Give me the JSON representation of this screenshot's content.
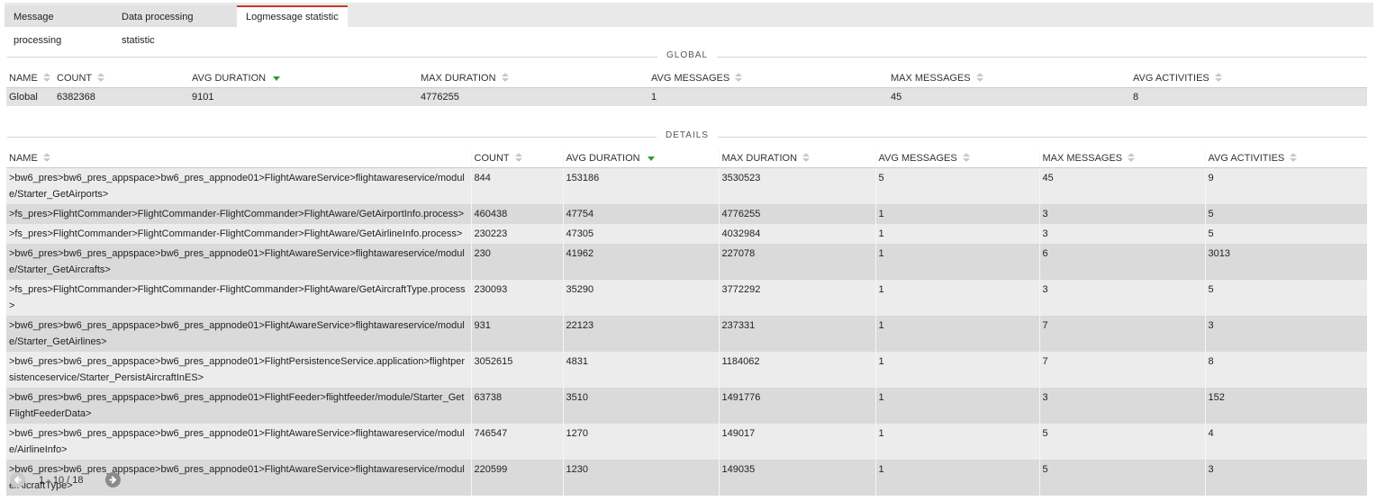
{
  "tabs": [
    {
      "label": "Message processing"
    },
    {
      "label": "Data processing statistic"
    },
    {
      "label": "Logmessage statistic"
    }
  ],
  "global": {
    "section_label": "GLOBAL",
    "headers": [
      "NAME",
      "COUNT",
      "AVG DURATION",
      "MAX DURATION",
      "AVG MESSAGES",
      "MAX MESSAGES",
      "AVG ACTIVITIES"
    ],
    "row": [
      "Global",
      "6382368",
      "9101",
      "4776255",
      "1",
      "45",
      "8"
    ]
  },
  "details": {
    "section_label": "DETAILS",
    "headers": [
      "NAME",
      "COUNT",
      "AVG DURATION",
      "MAX DURATION",
      "AVG MESSAGES",
      "MAX MESSAGES",
      "AVG ACTIVITIES"
    ],
    "rows": [
      [
        ">bw6_pres>bw6_pres_appspace>bw6_pres_appnode01>FlightAwareService>flightawareservice/module/Starter_GetAirports>",
        "844",
        "153186",
        "3530523",
        "5",
        "45",
        "9"
      ],
      [
        ">fs_pres>FlightCommander>FlightCommander-FlightCommander>FlightAware/GetAirportInfo.process>",
        "460438",
        "47754",
        "4776255",
        "1",
        "3",
        "5"
      ],
      [
        ">fs_pres>FlightCommander>FlightCommander-FlightCommander>FlightAware/GetAirlineInfo.process>",
        "230223",
        "47305",
        "4032984",
        "1",
        "3",
        "5"
      ],
      [
        ">bw6_pres>bw6_pres_appspace>bw6_pres_appnode01>FlightAwareService>flightawareservice/module/Starter_GetAircrafts>",
        "230",
        "41962",
        "227078",
        "1",
        "6",
        "3013"
      ],
      [
        ">fs_pres>FlightCommander>FlightCommander-FlightCommander>FlightAware/GetAircraftType.process>",
        "230093",
        "35290",
        "3772292",
        "1",
        "3",
        "5"
      ],
      [
        ">bw6_pres>bw6_pres_appspace>bw6_pres_appnode01>FlightAwareService>flightawareservice/module/Starter_GetAirlines>",
        "931",
        "22123",
        "237331",
        "1",
        "7",
        "3"
      ],
      [
        ">bw6_pres>bw6_pres_appspace>bw6_pres_appnode01>FlightPersistenceService.application>flightpersistenceservice/Starter_PersistAircraftInES>",
        "3052615",
        "4831",
        "1184062",
        "1",
        "7",
        "8"
      ],
      [
        ">bw6_pres>bw6_pres_appspace>bw6_pres_appnode01>FlightFeeder>flightfeeder/module/Starter_GetFlightFeederData>",
        "63738",
        "3510",
        "1491776",
        "1",
        "3",
        "152"
      ],
      [
        ">bw6_pres>bw6_pres_appspace>bw6_pres_appnode01>FlightAwareService>flightawareservice/module/AirlineInfo>",
        "746547",
        "1270",
        "149017",
        "1",
        "5",
        "4"
      ],
      [
        ">bw6_pres>bw6_pres_appspace>bw6_pres_appnode01>FlightAwareService>flightawareservice/module/AicraftType>",
        "220599",
        "1230",
        "149035",
        "1",
        "5",
        "3"
      ]
    ]
  },
  "pager": {
    "info": "1 - 10 / 18",
    "prev_icon": "arrow-left-circle-icon",
    "next_icon": "arrow-right-circle-icon"
  }
}
